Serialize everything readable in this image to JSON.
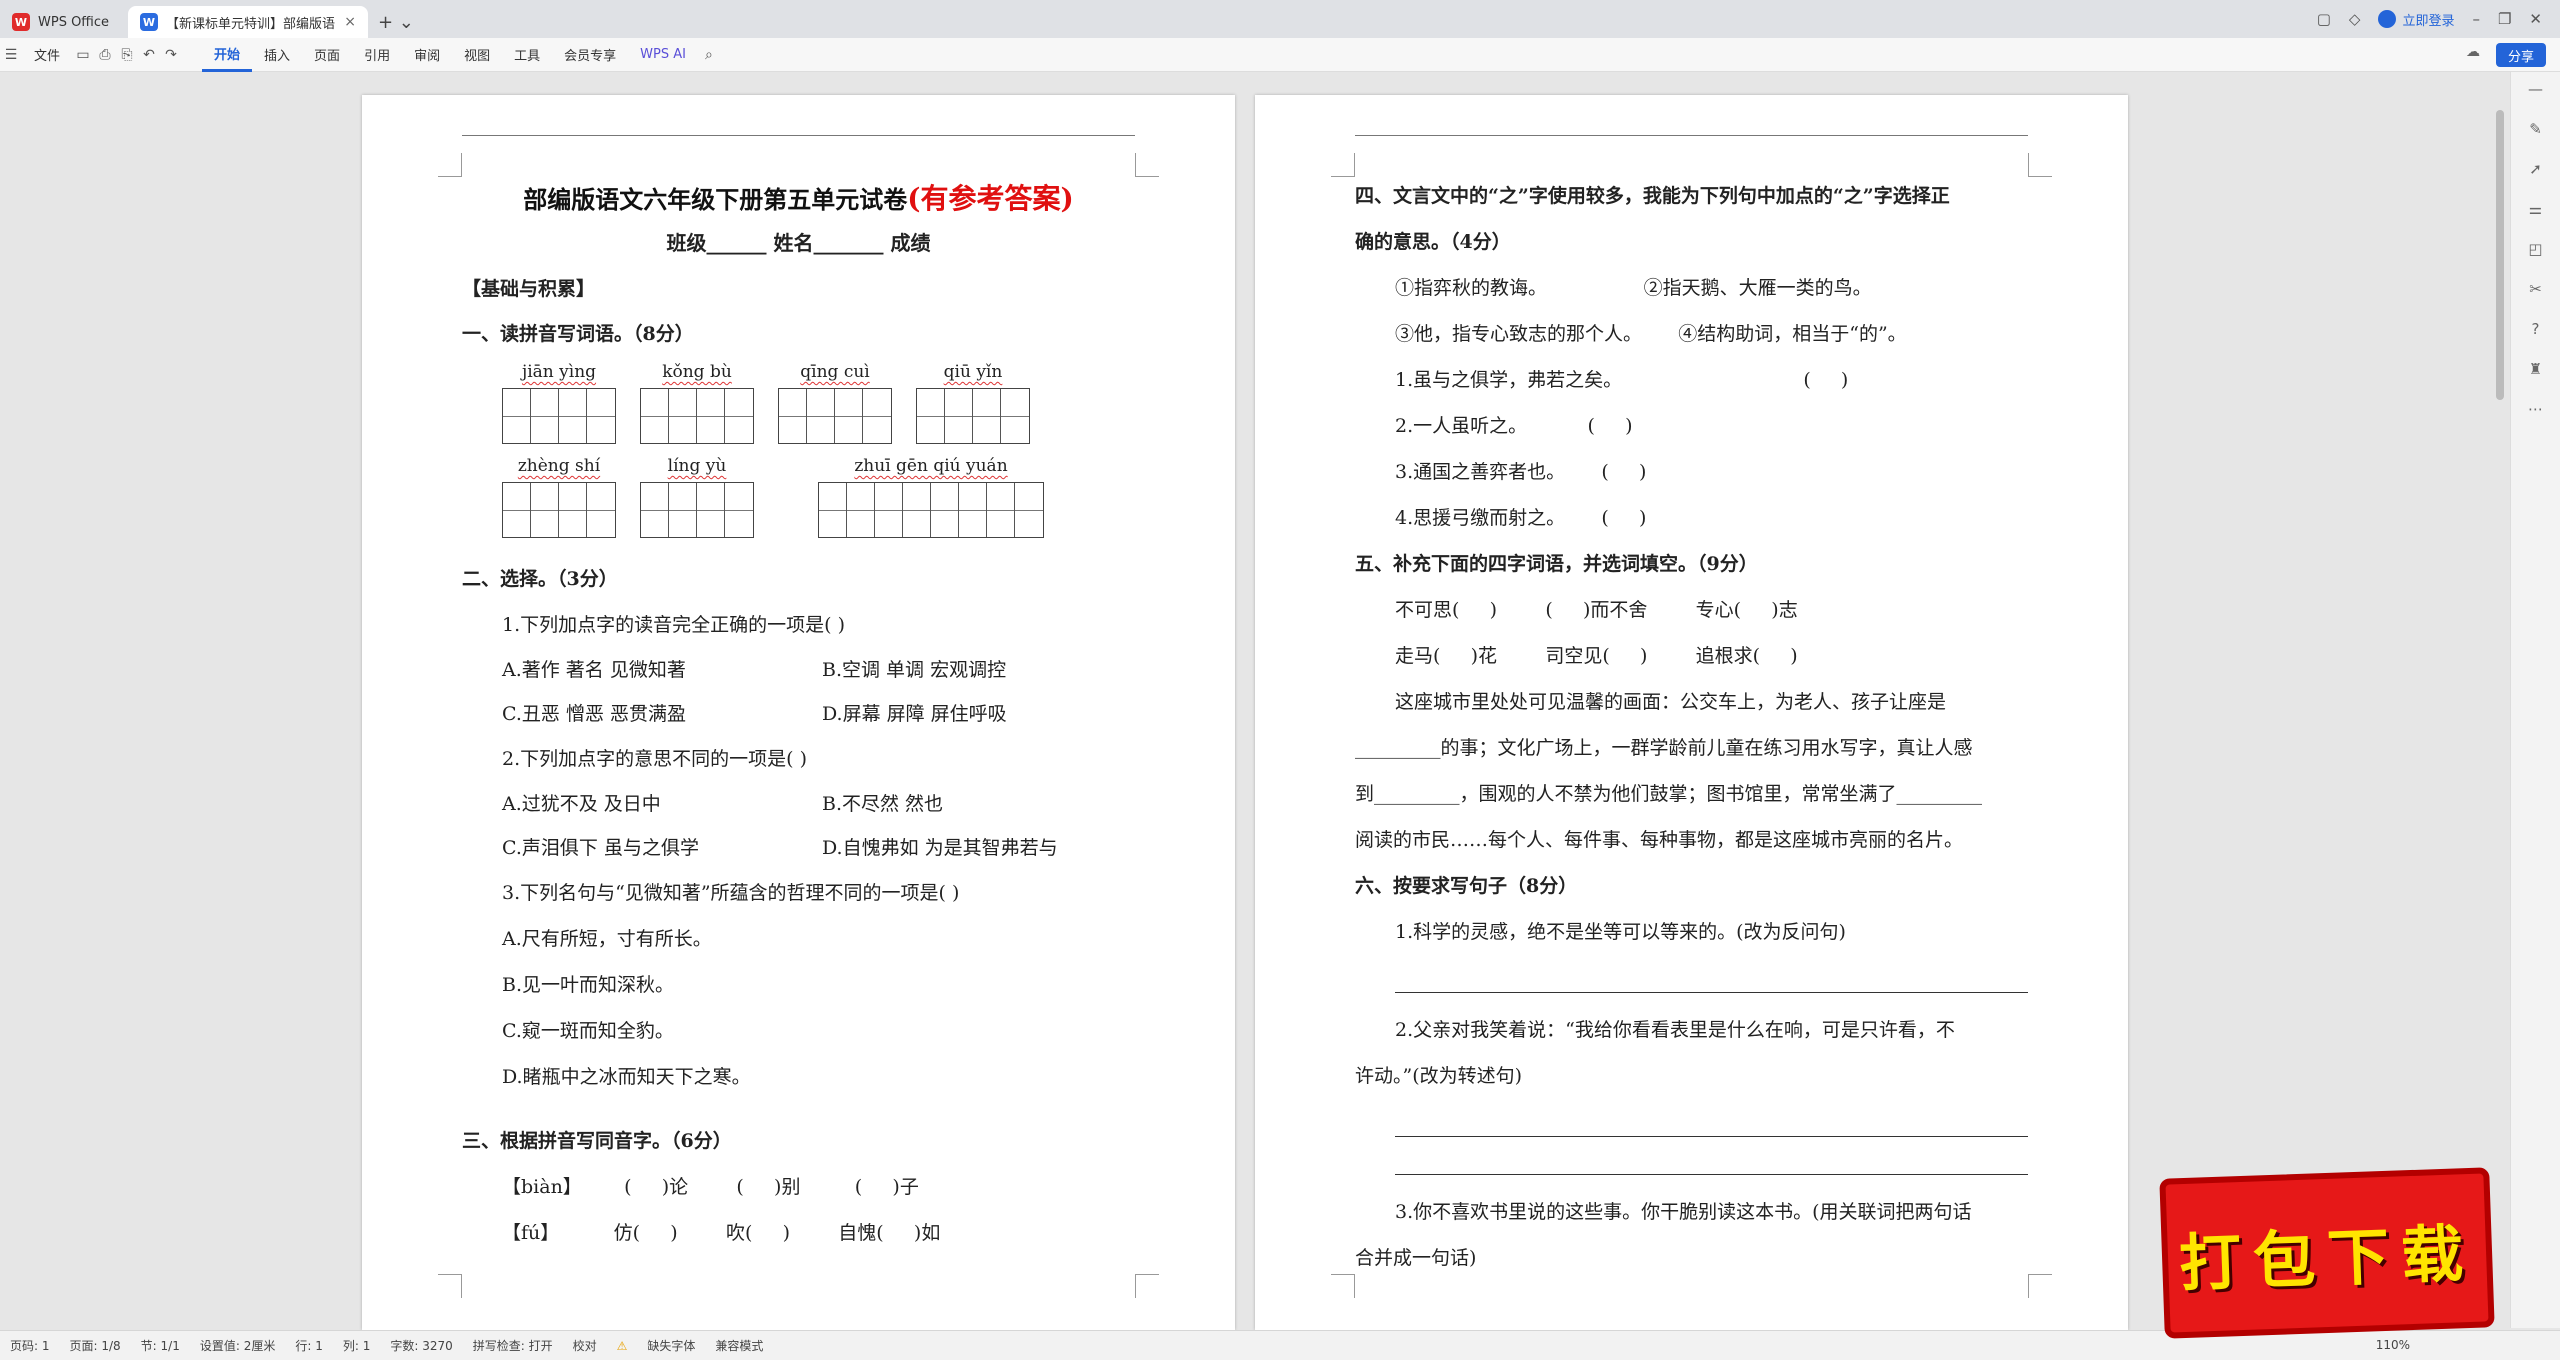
{
  "tabs": {
    "wps_label": "WPS Office",
    "doc_label": "【新课标单元特训】部编版语"
  },
  "topbar": {
    "login": "立即登录"
  },
  "ribbon": {
    "file": "文件",
    "tabs": [
      "开始",
      "插入",
      "页面",
      "引用",
      "审阅",
      "视图",
      "工具",
      "会员专享"
    ],
    "ai": "WPS AI",
    "share": "分享"
  },
  "page1": {
    "title": "部编版语文六年级下册第五单元试卷",
    "title_red": "(有参考答案)",
    "sub": "班级______  姓名_______  成绩",
    "s0": "【基础与积累】",
    "s1": "一、读拼音写词语。（8分）",
    "py": [
      "jiān yìng",
      "kǒng bù",
      "qīng cuì",
      "qiū yǐn",
      "zhèng shí",
      "líng yù",
      "zhuī gēn qiú yuán"
    ],
    "s2": "二、选择。（3分）",
    "q1": "1.下列加点字的读音完全正确的一项是(     )",
    "q1a": "A.著作    著名    见微知著",
    "q1b": "B.空调    单调    宏观调控",
    "q1c": "C.丑恶    憎恶    恶贯满盈",
    "q1d": "D.屏幕    屏障    屏住呼吸",
    "q2": "2.下列加点字的意思不同的一项是(     )",
    "q2a": "A.过犹不及      及日中",
    "q2b": "B.不尽然        然也",
    "q2c": "C.声泪俱下    虽与之俱学",
    "q2d": "D.自愧弗如    为是其智弗若与",
    "q3": "3.下列名句与“见微知著”所蕴含的哲理不同的一项是(     )",
    "q3a": "A.尺有所短，寸有所长。",
    "q3b": "B.见一叶而知深秋。",
    "q3c": "C.窥一斑而知全豹。",
    "q3d": "D.睹瓶中之冰而知天下之寒。",
    "s3": "三、根据拼音写同音字。（6分）",
    "h1": "【biàn】       (     )论        (     )别         (     )子",
    "h2": "【fú】         仿(     )        吹(     )        自愧(     )如"
  },
  "page2": {
    "s4": "四、文言文中的“之”字使用较多，我能为下列句中加点的“之”字选择正",
    "s4b": "确的意思。（4分）",
    "o1": "①指弈秋的教诲。                ②指天鹅、大雁一类的鸟。",
    "o2": "③他，指专心致志的那个人。      ④结构助词，相当于“的”。",
    "z1": "1.虽与之俱学，弗若之矣。                              (     )",
    "z2": "2.一人虽听之。          (     )",
    "z3": "3.通国之善弈者也。      (     )",
    "z4": "4.思援弓缴而射之。      (     )",
    "s5": "五、补充下面的四字词语，并选词填空。（9分）",
    "w1": "不可思(     )        (     )而不舍        专心(     )志",
    "w2": "走马(     )花        司空见(     )        追根求(     )",
    "p1": "这座城市里处处可见温馨的画面：公交车上，为老人、孩子让座是",
    "p2": "_________的事；文化广场上，一群学龄前儿童在练习用水写字，真让人感",
    "p3": "到_________，围观的人不禁为他们鼓掌；图书馆里，常常坐满了_________",
    "p4": "阅读的市民……每个人、每件事、每种事物，都是这座城市亮丽的名片。",
    "s6": "六、按要求写句子（8分）",
    "j1": "1.科学的灵感，绝不是坐等可以等来的。(改为反问句)",
    "j2": "2.父亲对我笑着说：“我给你看看表里是什么在响，可是只许看，不",
    "j2b": "许动。”(改为转述句)",
    "j3": "3.你不喜欢书里说的这些事。你干脆别读这本书。(用关联词把两句话",
    "j3b": "合并成一句话)"
  },
  "status": {
    "page": "页码: 1",
    "pages": "页面: 1/8",
    "section": "节: 1/1",
    "setting": "设置值: 2厘米",
    "line": "行: 1",
    "col": "列: 1",
    "words": "字数: 3270",
    "spell": "拼写检查: 打开",
    "proof": "校对",
    "font": "缺失字体",
    "compat": "兼容模式",
    "zoom": "110%"
  },
  "promo": {
    "text": "打包下载"
  }
}
